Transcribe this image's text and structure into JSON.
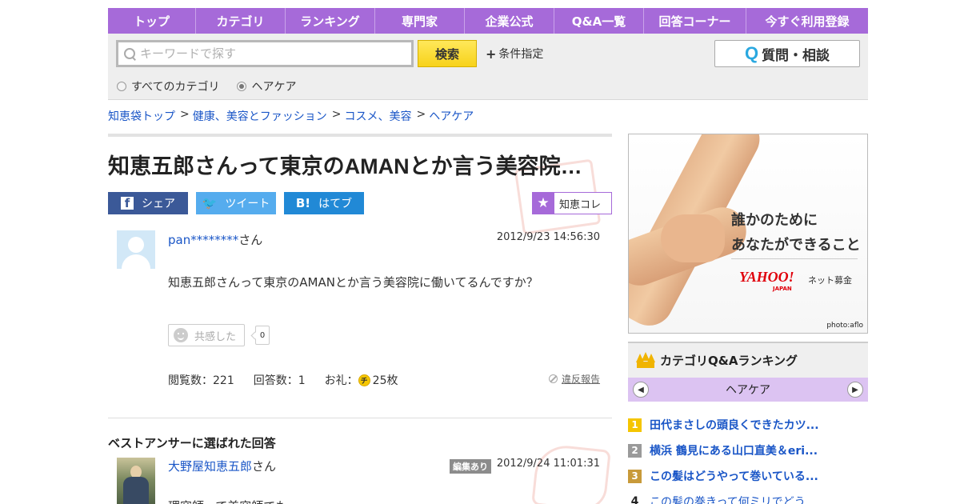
{
  "nav": {
    "items": [
      "トップ",
      "カテゴリ",
      "ランキング",
      "専門家",
      "企業公式",
      "Q&A一覧",
      "回答コーナー",
      "今すぐ利用登録"
    ]
  },
  "search": {
    "placeholder": "キーワードで探す",
    "button": "検索",
    "condition": "条件指定",
    "ask_button": "質問・相談",
    "ask_q": "Q",
    "radio_all": "すべてのカテゴリ",
    "radio_current": "ヘアケア"
  },
  "breadcrumb": [
    "知恵袋トップ",
    "健康、美容とファッション",
    "コスメ、美容",
    "ヘアケア"
  ],
  "question": {
    "title": "知恵五郎さんって東京のAMANとか言う美容院…",
    "user": "pan********",
    "san": "さん",
    "date": "2012/9/23  14:56:30",
    "body": "知恵五郎さんって東京のAMANとか言う美容院に働いてるんですか？",
    "kyokan_label": "共感した",
    "kyokan_count": "0",
    "views_label": "閲覧数：221",
    "answers_label": "回答数：1",
    "reward_label": "お礼：",
    "coin": "チ",
    "reward_value": "25枚",
    "report": "違反報告"
  },
  "share": {
    "facebook": "シェア",
    "facebook_icon": "f",
    "twitter": "ツイート",
    "twitter_icon": "🐦",
    "hatena": "はてブ",
    "hatena_icon": "B!",
    "chie_colle": "知恵コレ",
    "star": "★"
  },
  "best_answer": {
    "heading": "ベストアンサーに選ばれた回答",
    "user": "大野屋知恵五郎",
    "san": "さん",
    "edited": "編集あり",
    "date": "2012/9/24  11:01:31",
    "body": "理容師って美容師でも"
  },
  "ad": {
    "line1": "誰かのために",
    "line2": "あなたができること",
    "brand": "YAHOO!",
    "brand_sub": "JAPAN",
    "service": "ネット募金",
    "credit": "photo:aflo"
  },
  "ranking": {
    "heading": "カテゴリQ&Aランキング",
    "tab": "ヘアケア",
    "prev": "◀",
    "next": "▶",
    "items": [
      {
        "rank": "1",
        "text": "田代まさしの頭良くできたカツ...",
        "color": "#f5c500"
      },
      {
        "rank": "2",
        "text": "横浜 鶴見にある山口直美＆eri...",
        "color": "#9a9a9a"
      },
      {
        "rank": "3",
        "text": "この髪はどうやって巻いている...",
        "color": "#c89a3a"
      },
      {
        "rank": "4",
        "text": "この髪の巻きって何ミリでどう...",
        "color": ""
      }
    ]
  },
  "colors": {
    "accent": "#a66ad9",
    "link": "#1a56c7",
    "facebook": "#3b5998",
    "twitter": "#55acee",
    "hatena": "#2189d6"
  }
}
